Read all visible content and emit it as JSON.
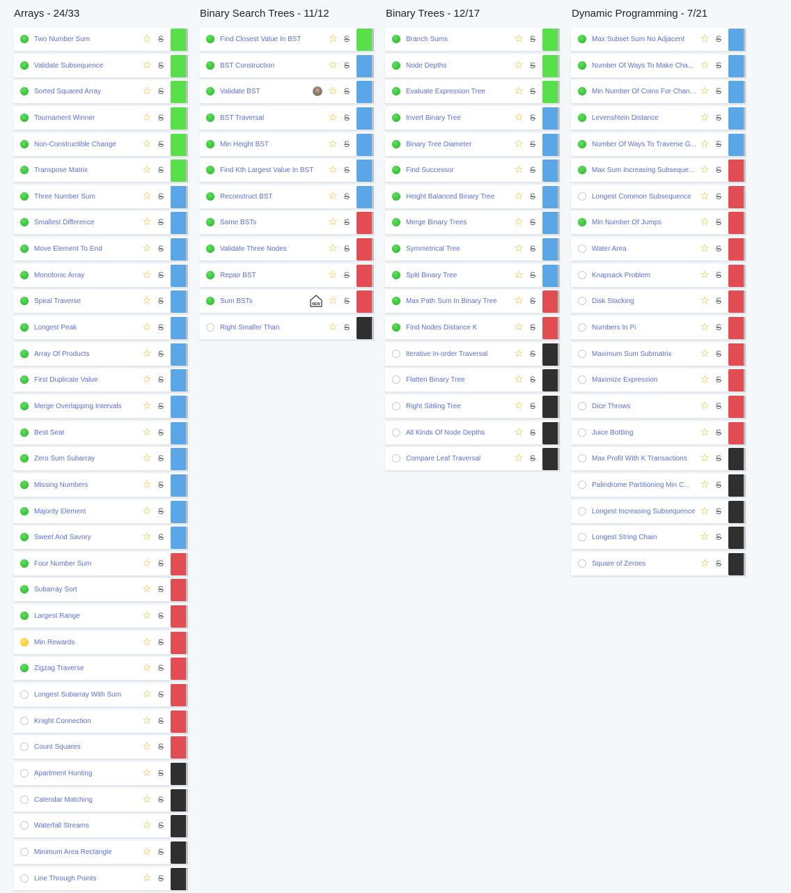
{
  "colors": {
    "easy": "#58e04a",
    "medium": "#5aa6e6",
    "hard": "#e24c53",
    "very_hard": "#2f2f2f",
    "link_text": "#5b6fdc",
    "star": "#f4b400"
  },
  "icons": {
    "star": "☆",
    "strike": "S",
    "new_label": "NEW"
  },
  "columns": [
    {
      "title": "Arrays - 24/33",
      "items": [
        {
          "label": "Two Number Sum",
          "status": "done",
          "difficulty": "easy"
        },
        {
          "label": "Validate Subsequence",
          "status": "done",
          "difficulty": "easy"
        },
        {
          "label": "Sorted Squared Array",
          "status": "done",
          "difficulty": "easy"
        },
        {
          "label": "Tournament Winner",
          "status": "done",
          "difficulty": "easy"
        },
        {
          "label": "Non-Constructible Change",
          "status": "done",
          "difficulty": "easy"
        },
        {
          "label": "Transpose Matrix",
          "status": "done",
          "difficulty": "easy"
        },
        {
          "label": "Three Number Sum",
          "status": "done",
          "difficulty": "medium"
        },
        {
          "label": "Smallest Difference",
          "status": "done",
          "difficulty": "medium"
        },
        {
          "label": "Move Element To End",
          "status": "done",
          "difficulty": "medium"
        },
        {
          "label": "Monotonic Array",
          "status": "done",
          "difficulty": "medium"
        },
        {
          "label": "Spiral Traverse",
          "status": "done",
          "difficulty": "medium"
        },
        {
          "label": "Longest Peak",
          "status": "done",
          "difficulty": "medium"
        },
        {
          "label": "Array Of Products",
          "status": "done",
          "difficulty": "medium"
        },
        {
          "label": "First Duplicate Value",
          "status": "done",
          "difficulty": "medium"
        },
        {
          "label": "Merge Overlapping Intervals",
          "status": "done",
          "difficulty": "medium"
        },
        {
          "label": "Best Seat",
          "status": "done",
          "difficulty": "medium"
        },
        {
          "label": "Zero Sum Subarray",
          "status": "done",
          "difficulty": "medium"
        },
        {
          "label": "Missing Numbers",
          "status": "done",
          "difficulty": "medium"
        },
        {
          "label": "Majority Element",
          "status": "done",
          "difficulty": "medium"
        },
        {
          "label": "Sweet And Savory",
          "status": "done",
          "difficulty": "medium"
        },
        {
          "label": "Four Number Sum",
          "status": "done",
          "difficulty": "hard"
        },
        {
          "label": "Subarray Sort",
          "status": "done",
          "difficulty": "hard"
        },
        {
          "label": "Largest Range",
          "status": "done",
          "difficulty": "hard"
        },
        {
          "label": "Min Rewards",
          "status": "partial",
          "difficulty": "hard"
        },
        {
          "label": "Zigzag Traverse",
          "status": "done",
          "difficulty": "hard"
        },
        {
          "label": "Longest Subarray With Sum",
          "status": "todo",
          "difficulty": "hard"
        },
        {
          "label": "Knight Connection",
          "status": "todo",
          "difficulty": "hard"
        },
        {
          "label": "Count Squares",
          "status": "todo",
          "difficulty": "hard"
        },
        {
          "label": "Apartment Hunting",
          "status": "todo",
          "difficulty": "very_hard"
        },
        {
          "label": "Calendar Matching",
          "status": "todo",
          "difficulty": "very_hard"
        },
        {
          "label": "Waterfall Streams",
          "status": "todo",
          "difficulty": "very_hard"
        },
        {
          "label": "Minimum Area Rectangle",
          "status": "todo",
          "difficulty": "very_hard"
        },
        {
          "label": "Line Through Points",
          "status": "todo",
          "difficulty": "very_hard"
        }
      ]
    },
    {
      "title": "Binary Search Trees - 11/12",
      "items": [
        {
          "label": "Find Closest Value In BST",
          "status": "done",
          "difficulty": "easy"
        },
        {
          "label": "BST Construction",
          "status": "done",
          "difficulty": "medium"
        },
        {
          "label": "Validate BST",
          "status": "done",
          "difficulty": "medium",
          "extra": "avatar"
        },
        {
          "label": "BST Traversal",
          "status": "done",
          "difficulty": "medium"
        },
        {
          "label": "Min Height BST",
          "status": "done",
          "difficulty": "medium"
        },
        {
          "label": "Find Kth Largest Value In BST",
          "status": "done",
          "difficulty": "medium"
        },
        {
          "label": "Reconstruct BST",
          "status": "done",
          "difficulty": "medium"
        },
        {
          "label": "Same BSTs",
          "status": "done",
          "difficulty": "hard"
        },
        {
          "label": "Validate Three Nodes",
          "status": "done",
          "difficulty": "hard"
        },
        {
          "label": "Repair BST",
          "status": "done",
          "difficulty": "hard"
        },
        {
          "label": "Sum BSTs",
          "status": "done",
          "difficulty": "hard",
          "extra": "new"
        },
        {
          "label": "Right Smaller Than",
          "status": "todo",
          "difficulty": "very_hard"
        }
      ]
    },
    {
      "title": "Binary Trees - 12/17",
      "items": [
        {
          "label": "Branch Sums",
          "status": "done",
          "difficulty": "easy"
        },
        {
          "label": "Node Depths",
          "status": "done",
          "difficulty": "easy"
        },
        {
          "label": "Evaluate Expression Tree",
          "status": "done",
          "difficulty": "easy"
        },
        {
          "label": "Invert Binary Tree",
          "status": "done",
          "difficulty": "medium"
        },
        {
          "label": "Binary Tree Diameter",
          "status": "done",
          "difficulty": "medium"
        },
        {
          "label": "Find Successor",
          "status": "done",
          "difficulty": "medium"
        },
        {
          "label": "Height Balanced Binary Tree",
          "status": "done",
          "difficulty": "medium"
        },
        {
          "label": "Merge Binary Trees",
          "status": "done",
          "difficulty": "medium"
        },
        {
          "label": "Symmetrical Tree",
          "status": "done",
          "difficulty": "medium"
        },
        {
          "label": "Split Binary Tree",
          "status": "done",
          "difficulty": "medium"
        },
        {
          "label": "Max Path Sum In Binary Tree",
          "status": "done",
          "difficulty": "hard"
        },
        {
          "label": "Find Nodes Distance K",
          "status": "done",
          "difficulty": "hard"
        },
        {
          "label": "Iterative In-order Traversal",
          "status": "todo",
          "difficulty": "very_hard"
        },
        {
          "label": "Flatten Binary Tree",
          "status": "todo",
          "difficulty": "very_hard"
        },
        {
          "label": "Right Sibling Tree",
          "status": "todo",
          "difficulty": "very_hard"
        },
        {
          "label": "All Kinds Of Node Depths",
          "status": "todo",
          "difficulty": "very_hard"
        },
        {
          "label": "Compare Leaf Traversal",
          "status": "todo",
          "difficulty": "very_hard"
        }
      ]
    },
    {
      "title": "Dynamic Programming - 7/21",
      "items": [
        {
          "label": "Max Subset Sum No Adjacent",
          "status": "done",
          "difficulty": "medium"
        },
        {
          "label": "Number Of Ways To Make Cha...",
          "status": "done",
          "difficulty": "medium"
        },
        {
          "label": "Min Number Of Coins For Chan...",
          "status": "done",
          "difficulty": "medium"
        },
        {
          "label": "Levenshtein Distance",
          "status": "done",
          "difficulty": "medium"
        },
        {
          "label": "Number Of Ways To Traverse G...",
          "status": "done",
          "difficulty": "medium"
        },
        {
          "label": "Max Sum Increasing Subseque...",
          "status": "done",
          "difficulty": "hard"
        },
        {
          "label": "Longest Common Subsequence",
          "status": "todo",
          "difficulty": "hard"
        },
        {
          "label": "Min Number Of Jumps",
          "status": "done",
          "difficulty": "hard"
        },
        {
          "label": "Water Area",
          "status": "todo",
          "difficulty": "hard"
        },
        {
          "label": "Knapsack Problem",
          "status": "todo",
          "difficulty": "hard"
        },
        {
          "label": "Disk Stacking",
          "status": "todo",
          "difficulty": "hard"
        },
        {
          "label": "Numbers In Pi",
          "status": "todo",
          "difficulty": "hard"
        },
        {
          "label": "Maximum Sum Submatrix",
          "status": "todo",
          "difficulty": "hard"
        },
        {
          "label": "Maximize Expression",
          "status": "todo",
          "difficulty": "hard"
        },
        {
          "label": "Dice Throws",
          "status": "todo",
          "difficulty": "hard"
        },
        {
          "label": "Juice Bottling",
          "status": "todo",
          "difficulty": "hard"
        },
        {
          "label": "Max Profit With K Transactions",
          "status": "todo",
          "difficulty": "very_hard"
        },
        {
          "label": "Palindrome Partitioning Min C...",
          "status": "todo",
          "difficulty": "very_hard"
        },
        {
          "label": "Longest Increasing Subsequence",
          "status": "todo",
          "difficulty": "very_hard"
        },
        {
          "label": "Longest String Chain",
          "status": "todo",
          "difficulty": "very_hard"
        },
        {
          "label": "Square of Zeroes",
          "status": "todo",
          "difficulty": "very_hard"
        }
      ]
    }
  ]
}
